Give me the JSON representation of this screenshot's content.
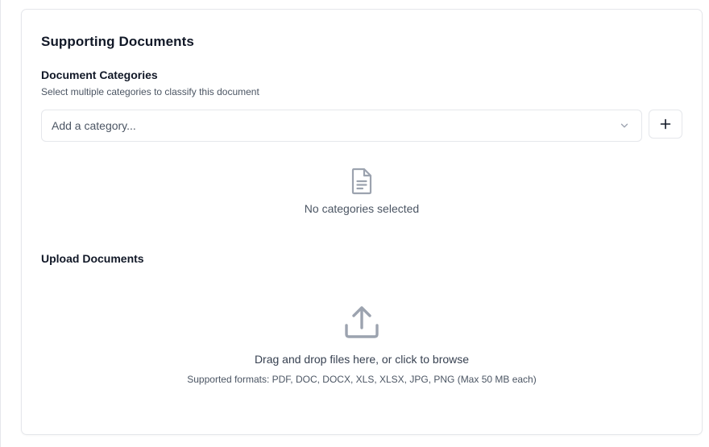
{
  "section": {
    "title": "Supporting Documents"
  },
  "categories": {
    "label": "Document Categories",
    "hint": "Select multiple categories to classify this document",
    "select_placeholder": "Add a category...",
    "add_button_label": "+",
    "empty_text": "No categories selected",
    "icons": {
      "chevron": "chevron-down-icon",
      "empty": "document-icon"
    }
  },
  "upload": {
    "label": "Upload Documents",
    "drop_text": "Drag and drop files here, or click to browse",
    "formats_text": "Supported formats: PDF, DOC, DOCX, XLS, XLSX, JPG, PNG (Max 50 MB each)",
    "icon": "upload-icon"
  },
  "colors": {
    "border": "#e5e7eb",
    "icon_gray": "#9ca3af",
    "text_muted": "#4b5563",
    "text_primary": "#111827"
  }
}
